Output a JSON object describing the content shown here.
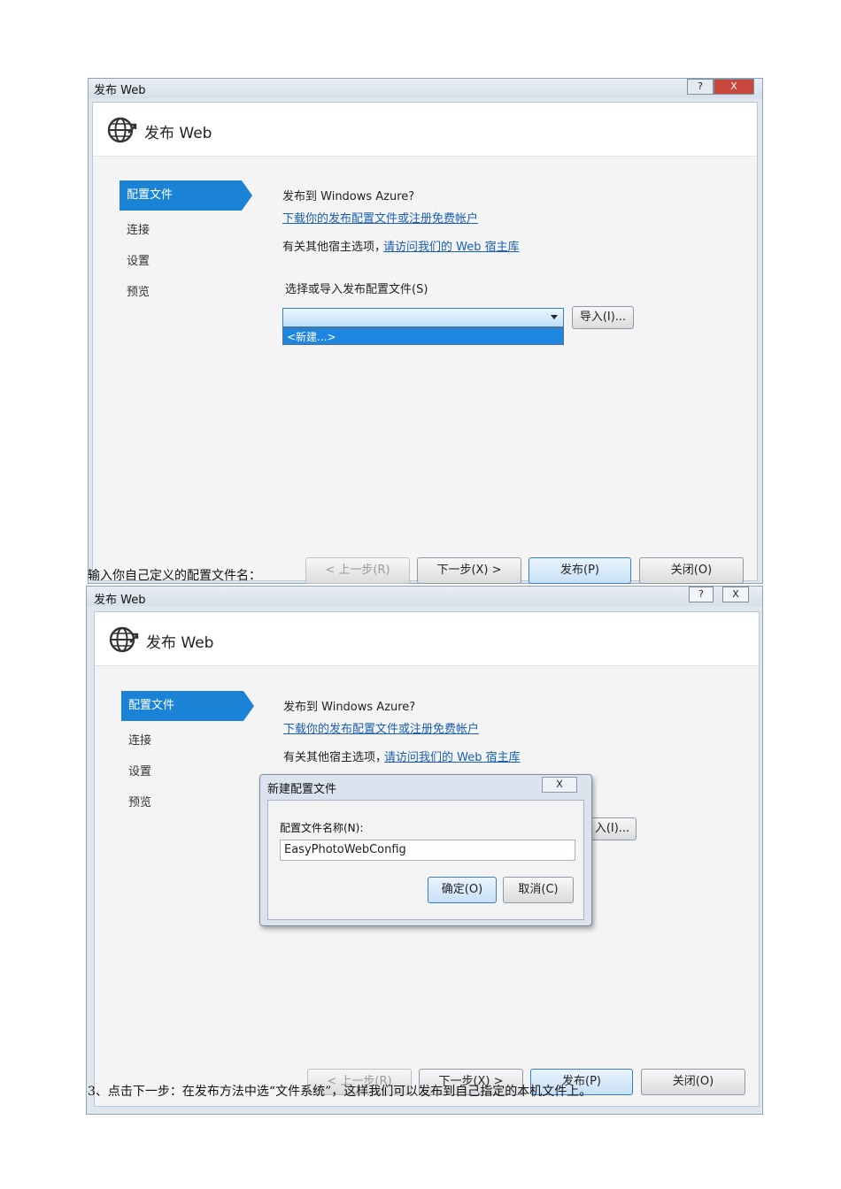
{
  "screenshot1": {
    "window_title": "发布 Web",
    "header_title": "发布 Web",
    "nav": [
      "配置文件",
      "连接",
      "设置",
      "预览"
    ],
    "publish_question": "发布到 Windows Azure?",
    "download_link": "下载你的发布配置文件或注册免费帐户",
    "hosting_text": "有关其他宿主选项，",
    "hosting_link": "请访问我们的 Web 宿主库",
    "select_label": "选择或导入发布配置文件(S)",
    "dropdown_value": "",
    "dropdown_option": "<新建...>",
    "import_button": "导入(I)...",
    "prev_button": "< 上一步(R)",
    "next_button": "下一步(X) >",
    "publish_button": "发布(P)",
    "close_button": "关闭(O)",
    "help_glyph": "?",
    "close_glyph": "X"
  },
  "caption1": "输入你自己定义的配置文件名：",
  "screenshot2": {
    "window_title": "发布 Web",
    "header_title": "发布 Web",
    "nav": [
      "配置文件",
      "连接",
      "设置",
      "预览"
    ],
    "publish_question": "发布到 Windows Azure?",
    "download_link": "下载你的发布配置文件或注册免费帐户",
    "hosting_text": "有关其他宿主选项，",
    "hosting_link": "请访问我们的 Web 宿主库",
    "import_button_partial": "入(I)...",
    "prev_button": "< 上一步(R)",
    "next_button": "下一步(X) >",
    "publish_button": "发布(P)",
    "close_button": "关闭(O)",
    "help_glyph": "?",
    "close_glyph": "X",
    "dialog": {
      "title": "新建配置文件",
      "close_glyph": "X",
      "field_label": "配置文件名称(N):",
      "field_value": "EasyPhotoWebConfig",
      "ok_button": "确定(O)",
      "cancel_button": "取消(C)"
    }
  },
  "caption2": "3、点击下一步：在发布方法中选“文件系统”，这样我们可以发布到自己指定的本机文件上。",
  "colors": {
    "accent": "#1b83d6",
    "link": "#1a5fb4"
  }
}
